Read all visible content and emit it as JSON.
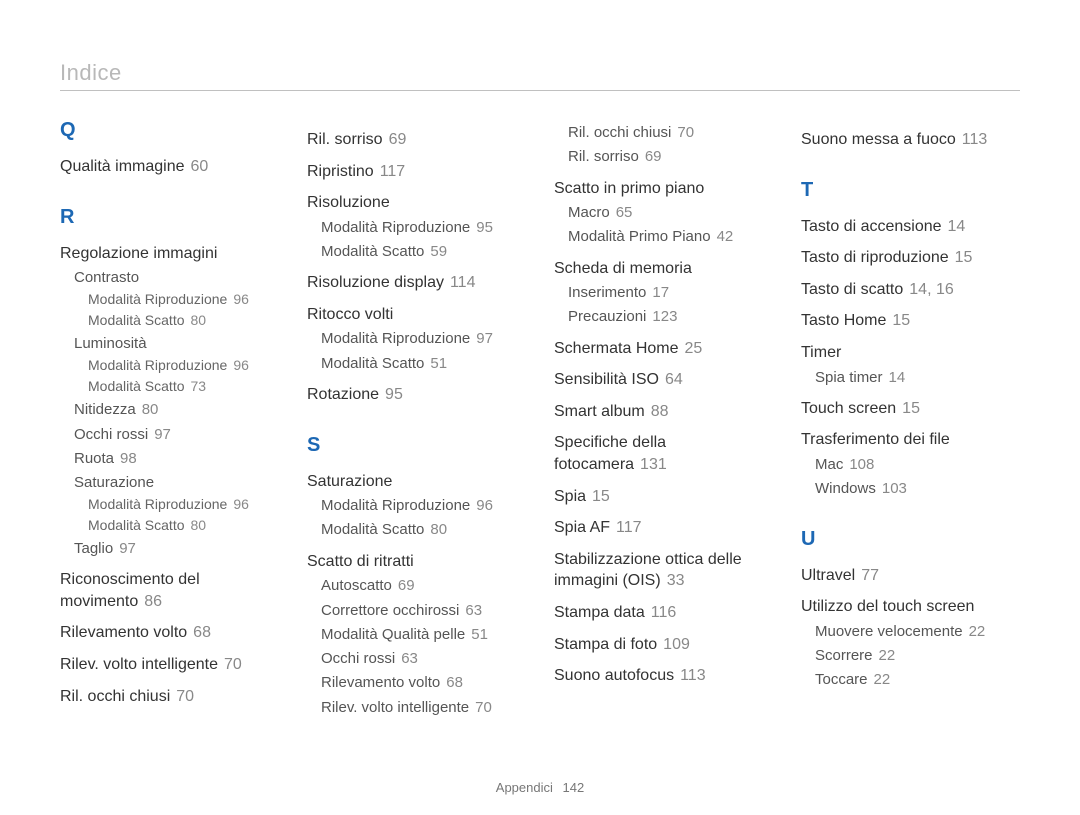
{
  "header": {
    "title": "Indice"
  },
  "footer": {
    "label": "Appendici",
    "page": "142"
  },
  "columns": [
    {
      "blocks": [
        {
          "type": "letter",
          "text": "Q"
        },
        {
          "type": "entry",
          "text": "Qualità immagine",
          "page": "60"
        },
        {
          "type": "letter",
          "text": "R"
        },
        {
          "type": "entry",
          "text": "Regolazione immagini"
        },
        {
          "type": "sub",
          "text": "Contrasto"
        },
        {
          "type": "subsub",
          "text": "Modalità Riproduzione",
          "page": "96"
        },
        {
          "type": "subsub",
          "text": "Modalità Scatto",
          "page": "80"
        },
        {
          "type": "sub",
          "text": "Luminosità"
        },
        {
          "type": "subsub",
          "text": "Modalità Riproduzione",
          "page": "96"
        },
        {
          "type": "subsub",
          "text": "Modalità Scatto",
          "page": "73"
        },
        {
          "type": "sub",
          "text": "Nitidezza",
          "page": "80"
        },
        {
          "type": "sub",
          "text": "Occhi rossi",
          "page": "97"
        },
        {
          "type": "sub",
          "text": "Ruota",
          "page": "98"
        },
        {
          "type": "sub",
          "text": "Saturazione"
        },
        {
          "type": "subsub",
          "text": "Modalità Riproduzione",
          "page": "96"
        },
        {
          "type": "subsub",
          "text": "Modalità Scatto",
          "page": "80"
        },
        {
          "type": "sub",
          "text": "Taglio",
          "page": "97"
        },
        {
          "type": "entry",
          "text": "Riconoscimento del movimento",
          "page": "86"
        },
        {
          "type": "entry",
          "text": "Rilevamento volto",
          "page": "68"
        },
        {
          "type": "entry",
          "text": "Rilev. volto intelligente",
          "page": "70"
        },
        {
          "type": "entry",
          "text": "Ril. occhi chiusi",
          "page": "70"
        }
      ]
    },
    {
      "blocks": [
        {
          "type": "entry",
          "text": "Ril. sorriso",
          "page": "69"
        },
        {
          "type": "entry",
          "text": "Ripristino",
          "page": "117"
        },
        {
          "type": "entry",
          "text": "Risoluzione"
        },
        {
          "type": "sub",
          "text": "Modalità Riproduzione",
          "page": "95"
        },
        {
          "type": "sub",
          "text": "Modalità Scatto",
          "page": "59"
        },
        {
          "type": "entry",
          "text": "Risoluzione display",
          "page": "114"
        },
        {
          "type": "entry",
          "text": "Ritocco volti"
        },
        {
          "type": "sub",
          "text": "Modalità Riproduzione",
          "page": "97"
        },
        {
          "type": "sub",
          "text": "Modalità Scatto",
          "page": "51"
        },
        {
          "type": "entry",
          "text": "Rotazione",
          "page": "95"
        },
        {
          "type": "letter",
          "text": "S"
        },
        {
          "type": "entry",
          "text": "Saturazione"
        },
        {
          "type": "sub",
          "text": "Modalità Riproduzione",
          "page": "96"
        },
        {
          "type": "sub",
          "text": "Modalità Scatto",
          "page": "80"
        },
        {
          "type": "entry",
          "text": "Scatto di ritratti"
        },
        {
          "type": "sub",
          "text": "Autoscatto",
          "page": "69"
        },
        {
          "type": "sub",
          "text": "Correttore occhirossi",
          "page": "63"
        },
        {
          "type": "sub",
          "text": "Modalità Qualità pelle",
          "page": "51"
        },
        {
          "type": "sub",
          "text": "Occhi rossi",
          "page": "63"
        },
        {
          "type": "sub",
          "text": "Rilevamento volto",
          "page": "68"
        },
        {
          "type": "sub",
          "text": "Rilev. volto intelligente",
          "page": "70"
        }
      ]
    },
    {
      "blocks": [
        {
          "type": "sub",
          "text": "Ril. occhi chiusi",
          "page": "70"
        },
        {
          "type": "sub",
          "text": "Ril. sorriso",
          "page": "69"
        },
        {
          "type": "entry",
          "text": "Scatto in primo piano"
        },
        {
          "type": "sub",
          "text": "Macro",
          "page": "65"
        },
        {
          "type": "sub",
          "text": "Modalità Primo Piano",
          "page": "42"
        },
        {
          "type": "entry",
          "text": "Scheda di memoria"
        },
        {
          "type": "sub",
          "text": "Inserimento",
          "page": "17"
        },
        {
          "type": "sub",
          "text": "Precauzioni",
          "page": "123"
        },
        {
          "type": "entry",
          "text": "Schermata Home",
          "page": "25"
        },
        {
          "type": "entry",
          "text": "Sensibilità ISO",
          "page": "64"
        },
        {
          "type": "entry",
          "text": "Smart album",
          "page": "88"
        },
        {
          "type": "entry",
          "text": "Specifiche della fotocamera",
          "page": "131"
        },
        {
          "type": "entry",
          "text": "Spia",
          "page": "15"
        },
        {
          "type": "entry",
          "text": "Spia AF",
          "page": "117"
        },
        {
          "type": "entry",
          "text": "Stabilizzazione ottica delle immagini (OIS)",
          "page": "33"
        },
        {
          "type": "entry",
          "text": "Stampa data",
          "page": "116"
        },
        {
          "type": "entry",
          "text": "Stampa di foto",
          "page": "109"
        },
        {
          "type": "entry",
          "text": "Suono autofocus",
          "page": "113"
        }
      ]
    },
    {
      "blocks": [
        {
          "type": "entry",
          "text": "Suono messa a fuoco",
          "page": "113"
        },
        {
          "type": "letter",
          "text": "T"
        },
        {
          "type": "entry",
          "text": "Tasto di accensione",
          "page": "14"
        },
        {
          "type": "entry",
          "text": "Tasto di riproduzione",
          "page": "15"
        },
        {
          "type": "entry",
          "text": "Tasto di scatto",
          "page": "14, 16"
        },
        {
          "type": "entry",
          "text": "Tasto Home",
          "page": "15"
        },
        {
          "type": "entry",
          "text": "Timer"
        },
        {
          "type": "sub",
          "text": "Spia timer",
          "page": "14"
        },
        {
          "type": "entry",
          "text": "Touch screen",
          "page": "15"
        },
        {
          "type": "entry",
          "text": "Trasferimento dei file"
        },
        {
          "type": "sub",
          "text": "Mac",
          "page": "108"
        },
        {
          "type": "sub",
          "text": "Windows",
          "page": "103"
        },
        {
          "type": "letter",
          "text": "U"
        },
        {
          "type": "entry",
          "text": "Ultravel",
          "page": "77"
        },
        {
          "type": "entry",
          "text": "Utilizzo del touch screen"
        },
        {
          "type": "sub",
          "text": "Muovere velocemente",
          "page": "22"
        },
        {
          "type": "sub",
          "text": "Scorrere",
          "page": "22"
        },
        {
          "type": "sub",
          "text": "Toccare",
          "page": "22"
        }
      ]
    }
  ]
}
